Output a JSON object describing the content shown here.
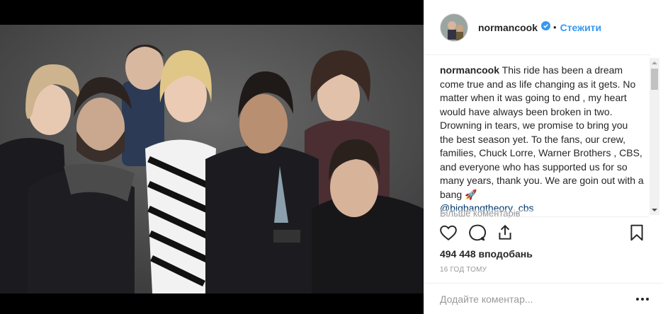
{
  "post": {
    "username": "normancook",
    "dot": "•",
    "follow_label": "Стежити",
    "caption_user": "normancook",
    "caption_text": " This ride has been a dream come true and as life changing as it gets. No matter when it was going to end , my heart would have always been broken in two. Drowning in tears, we promise to bring you the best season yet. To the fans, our crew, families, Chuck Lorre, Warner Brothers , CBS, and everyone who has supported us for so many years, thank you. We are goin out with a bang 🚀\n",
    "caption_mention": "@bigbangtheory_cbs",
    "more_comments": "Більше коментарів",
    "likes": "494 448 вподобань",
    "time": "16 ГОД ТОМУ",
    "comment_placeholder": "Додайте коментар..."
  },
  "icons": {
    "like": "heart-icon",
    "comment": "comment-icon",
    "share": "share-icon",
    "save": "bookmark-icon",
    "verified": "verified-badge-icon",
    "options": "more-options-icon"
  },
  "colors": {
    "link": "#3897f0",
    "verified": "#3897f0",
    "text": "#262626",
    "muted": "#999999"
  }
}
